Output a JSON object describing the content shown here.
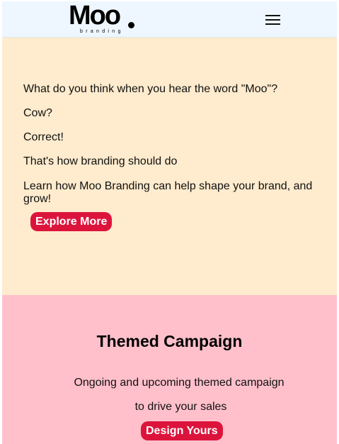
{
  "header": {
    "logo_text": "Moo",
    "logo_subtext": "branding",
    "menu_icon": "hamburger-menu-icon"
  },
  "hero": {
    "lines": [
      "What do you think when you hear the word \"Moo\"?",
      "Cow?",
      "Correct!",
      "That's how branding should do",
      "Learn how Moo Branding can help shape your brand, and grow!"
    ],
    "button_label": "Explore More"
  },
  "campaign": {
    "title": "Themed Campaign",
    "line1": "Ongoing and upcoming themed campaign",
    "line2": "to drive your sales",
    "button_label": "Design Yours"
  },
  "colors": {
    "header_bg": "#eef7ff",
    "hero_bg": "#ffebcd",
    "campaign_bg": "#ffc0cb",
    "button_bg": "#dc143c",
    "button_text": "#ffffff"
  }
}
